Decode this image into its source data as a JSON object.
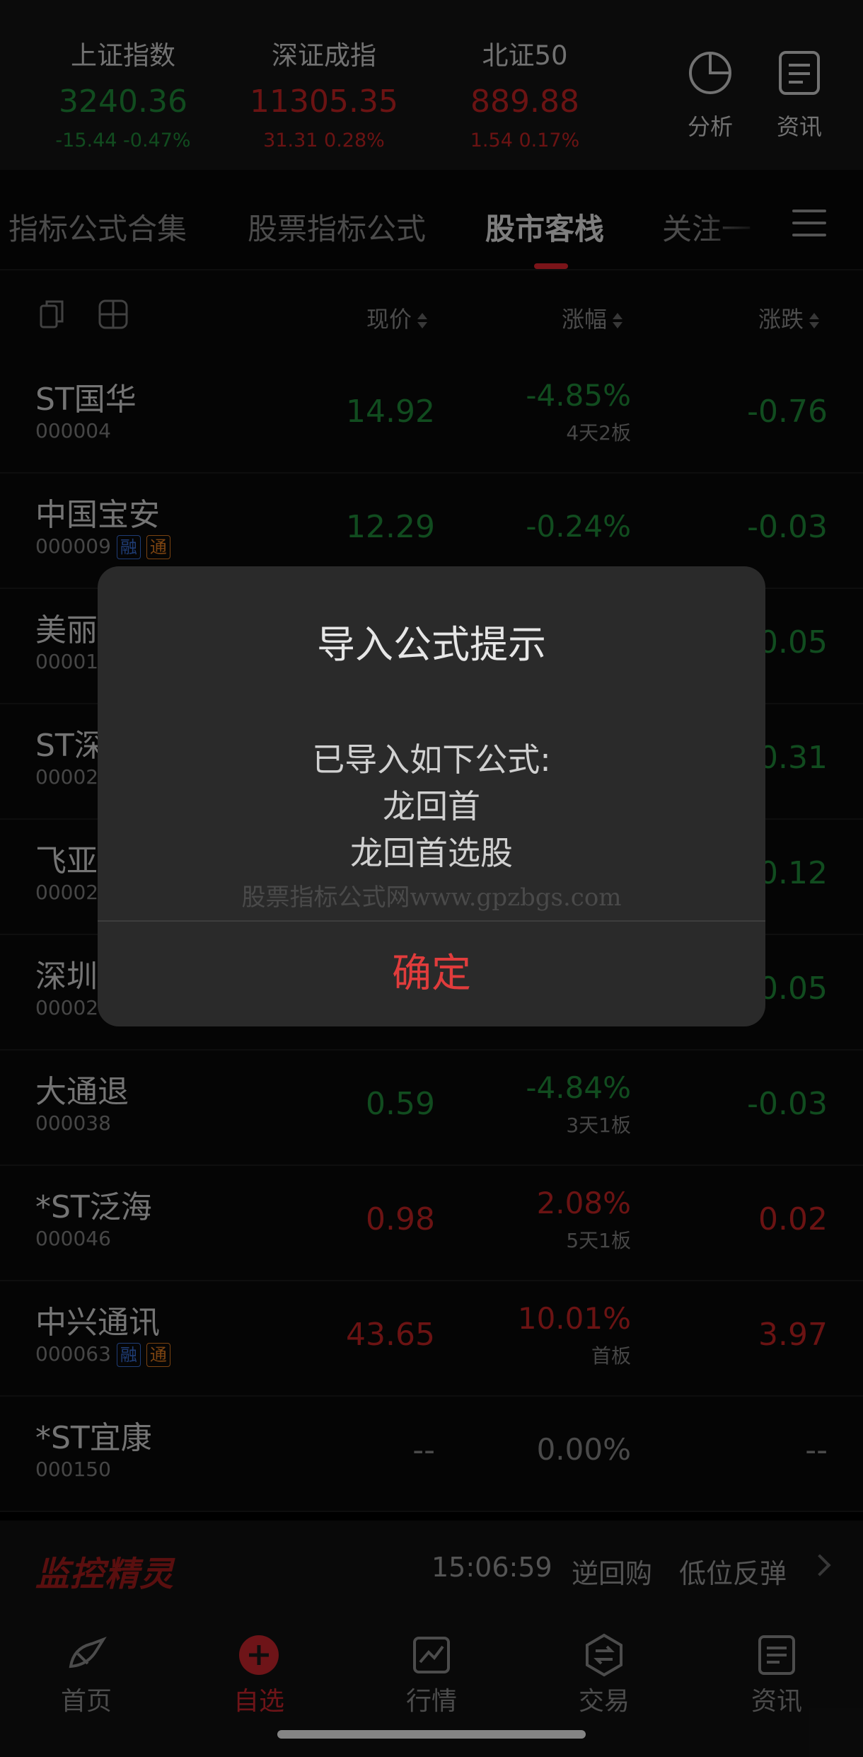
{
  "indices": [
    {
      "name": "上证指数",
      "value": "3240.36",
      "change": "-15.44  -0.47%",
      "dir": "down"
    },
    {
      "name": "深证成指",
      "value": "11305.35",
      "change": "31.31  0.28%",
      "dir": "up"
    },
    {
      "name": "北证50",
      "value": "889.88",
      "change": "1.54  0.17%",
      "dir": "up"
    }
  ],
  "top_actions": {
    "analysis": "分析",
    "news": "资讯"
  },
  "tabs": [
    "指标公式合集",
    "股票指标公式",
    "股市客栈",
    "关注一"
  ],
  "columns": {
    "price": "现价",
    "pct": "涨幅",
    "change": "涨跌"
  },
  "stocks": [
    {
      "name": "ST国华",
      "code": "000004",
      "price": "14.92",
      "pct": "-4.85%",
      "sub": "4天2板",
      "change": "-0.76",
      "dir": "down"
    },
    {
      "name": "中国宝安",
      "code": "000009",
      "tags": [
        "融",
        "通"
      ],
      "price": "12.29",
      "pct": "-0.24%",
      "sub": "",
      "change": "-0.03",
      "dir": "down"
    },
    {
      "name": "美丽",
      "code": "00001",
      "price": "",
      "pct": "",
      "sub": "",
      "change": "0.05",
      "dir": "down"
    },
    {
      "name": "ST深",
      "code": "00002",
      "price": "",
      "pct": "",
      "sub": "",
      "change": "0.31",
      "dir": "down"
    },
    {
      "name": "飞亚",
      "code": "00002",
      "price": "",
      "pct": "",
      "sub": "",
      "change": "0.12",
      "dir": "down"
    },
    {
      "name": "深圳",
      "code": "00002",
      "price": "",
      "pct": "",
      "sub": "",
      "change": "0.05",
      "dir": "down"
    },
    {
      "name": "大通退",
      "code": "000038",
      "price": "0.59",
      "pct": "-4.84%",
      "sub": "3天1板",
      "change": "-0.03",
      "dir": "down"
    },
    {
      "name": "*ST泛海",
      "code": "000046",
      "price": "0.98",
      "pct": "2.08%",
      "sub": "5天1板",
      "change": "0.02",
      "dir": "up"
    },
    {
      "name": "中兴通讯",
      "code": "000063",
      "tags": [
        "融",
        "通"
      ],
      "price": "43.65",
      "pct": "10.01%",
      "sub": "首板",
      "change": "3.97",
      "dir": "up"
    },
    {
      "name": "*ST宜康",
      "code": "000150",
      "price": "--",
      "pct": "0.00%",
      "sub": "",
      "change": "--",
      "dir": "flat"
    }
  ],
  "ticker": {
    "brand": "监控精灵",
    "time": "15:06:59",
    "note1": "逆回购",
    "note2": "低位反弹"
  },
  "nav": [
    {
      "label": "首页",
      "icon": "home-icon"
    },
    {
      "label": "自选",
      "icon": "plus-circle-icon"
    },
    {
      "label": "行情",
      "icon": "chart-icon"
    },
    {
      "label": "交易",
      "icon": "trade-icon"
    },
    {
      "label": "资讯",
      "icon": "news-icon"
    }
  ],
  "dialog": {
    "title": "导入公式提示",
    "body_line1": "已导入如下公式:",
    "body_line2": "龙回首",
    "body_line3": "龙回首选股",
    "watermark": "股票指标公式网www.gpzbgs.com",
    "confirm": "确定"
  },
  "colors": {
    "up": "#c32424",
    "down": "#1f8a3a",
    "accent": "#e0262e"
  }
}
